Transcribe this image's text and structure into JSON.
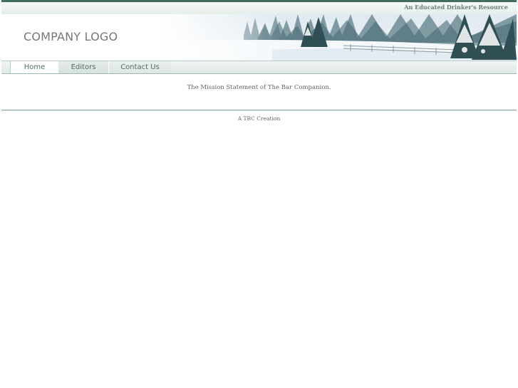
{
  "header": {
    "tagline": "An Educated Drinker's Resource",
    "logo_text": "COMPANY LOGO"
  },
  "nav": {
    "items": [
      {
        "label": "Home",
        "active": true
      },
      {
        "label": "Editors",
        "active": false
      },
      {
        "label": "Contact Us",
        "active": false
      }
    ]
  },
  "main": {
    "mission": "The Mission Statement of The Bar Companion."
  },
  "footer": {
    "credit": "A TBC Creation"
  },
  "colors": {
    "accent": "#3f6f62",
    "nav_text": "#556a63"
  }
}
